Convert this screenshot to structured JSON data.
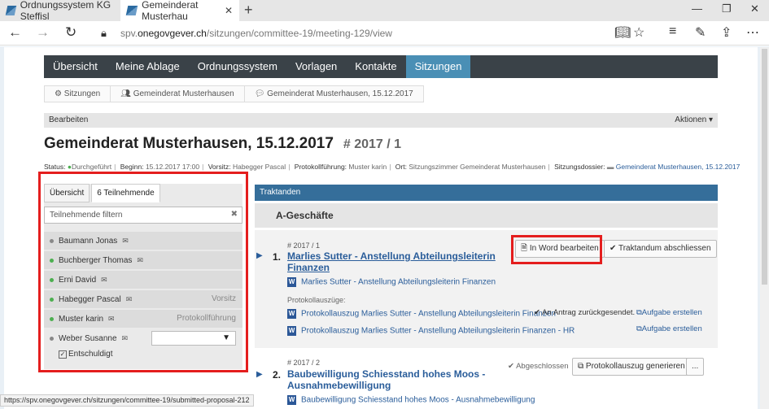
{
  "browser": {
    "tabs": [
      {
        "label": "Ordnungssystem KG Steffisl"
      },
      {
        "label": "Gemeinderat Musterhau"
      }
    ],
    "url_prefix": "spv.",
    "url_domain": "onegovgever.ch",
    "url_path": "/sitzungen/committee-19/meeting-129/view",
    "status_url": "https://spv.onegovgever.ch/sitzungen/committee-19/submitted-proposal-212"
  },
  "mainnav": [
    "Übersicht",
    "Meine Ablage",
    "Ordnungssystem",
    "Vorlagen",
    "Kontakte",
    "Sitzungen"
  ],
  "breadcrumb": [
    "Sitzungen",
    "Gemeinderat Musterhausen",
    "Gemeinderat Musterhausen, 15.12.2017"
  ],
  "editbar": {
    "left": "Bearbeiten",
    "right": "Aktionen ▾"
  },
  "meeting": {
    "title": "Gemeinderat Musterhausen, 15.12.2017",
    "number": "# 2017 / 1"
  },
  "meta": {
    "status_label": "Status:",
    "status_value": "Durchgeführt",
    "beginn_label": "Beginn:",
    "beginn_value": "15.12.2017 17:00",
    "vorsitz_label": "Vorsitz:",
    "vorsitz_value": "Habegger Pascal",
    "protokoll_label": "Protokollführung:",
    "protokoll_value": "Muster karin",
    "ort_label": "Ort:",
    "ort_value": "Sitzungszimmer Gemeinderat Musterhausen",
    "dossier_label": "Sitzungsdossier:",
    "dossier_value": "Gemeinderat Musterhausen, 15.12.2017"
  },
  "leftpanel": {
    "tabs": [
      "Übersicht",
      "6 Teilnehmende"
    ],
    "filter_placeholder": "Teilnehmende filtern",
    "participants": [
      {
        "name": "Baumann Jonas",
        "role": "",
        "color": "#888888"
      },
      {
        "name": "Buchberger Thomas",
        "role": "",
        "color": "#4caf50"
      },
      {
        "name": "Erni David",
        "role": "",
        "color": "#4caf50"
      },
      {
        "name": "Habegger Pascal",
        "role": "Vorsitz",
        "color": "#4caf50"
      },
      {
        "name": "Muster karin",
        "role": "Protokollführung",
        "color": "#4caf50"
      },
      {
        "name": "Weber Susanne",
        "role": "",
        "color": "#888888"
      }
    ],
    "excused_label": "Entschuldigt"
  },
  "traktanden": {
    "header": "Traktanden",
    "section": "A-Geschäfte",
    "item1": {
      "ref": "# 2017 / 1",
      "num": "1.",
      "title": "Marlies Sutter - Anstellung Abteilungsleiterin Finanzen",
      "btn_word": "In Word bearbeiten",
      "btn_close": "Traktandum abschliessen",
      "doc": "Marlies Sutter - Anstellung Abteilungsleiterin Finanzen",
      "excerpts_label": "Protokollauszüge:",
      "excerpt1": "Protokollauszug Marlies Sutter - Anstellung Abteilungsleiterin Finanzen",
      "excerpt1_status": "An Antrag zurückgesendet.",
      "excerpt2": "Protokollauszug Marlies Sutter - Anstellung Abteilungsleiterin Finanzen - HR",
      "task_label": "Aufgabe erstellen"
    },
    "item2": {
      "ref": "# 2017 / 2",
      "num": "2.",
      "title": "Baubewilligung Schiesstand hohes Moos - Ausnahmebewilligung",
      "status": "Abgeschlossen",
      "btn_generate": "Protokollauszug generieren",
      "btn_more": "...",
      "doc": "Baubewilligung Schiesstand hohes Moos - Ausnahmebewilligung"
    }
  },
  "colors": {
    "nav_bg": "#3a4248",
    "nav_active": "#4a8fb5",
    "highlight": "#e41e1e",
    "link": "#2a5d9a"
  }
}
